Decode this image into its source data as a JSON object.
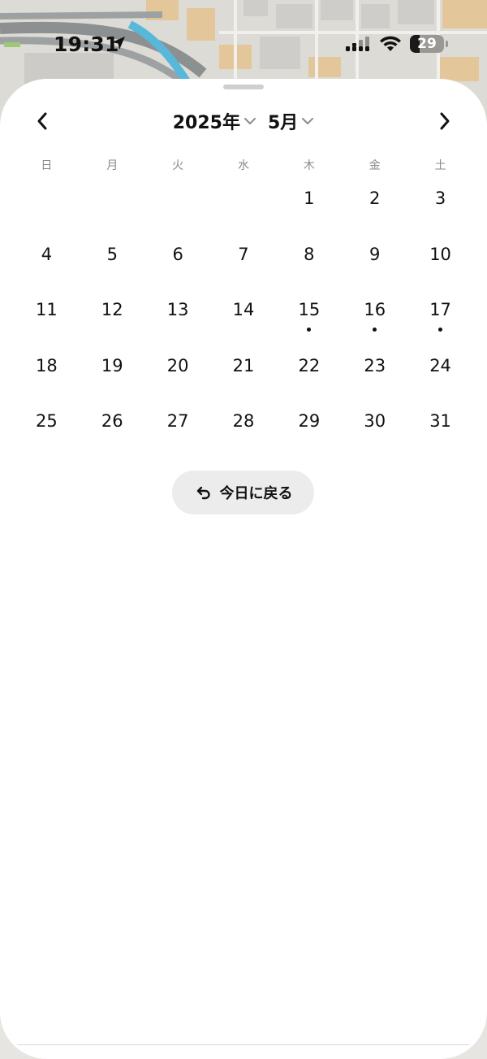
{
  "status_bar": {
    "time": "19:31",
    "battery_level": "29",
    "battery_fraction": 0.29
  },
  "icons": {
    "location": "location-arrow-icon",
    "signal": "cellular-signal-icon",
    "wifi": "wifi-icon",
    "battery": "battery-icon",
    "prev": "chevron-left-icon",
    "next": "chevron-right-icon",
    "dropdown": "chevron-down-icon",
    "back_to_today": "return-arrow-icon"
  },
  "calendar": {
    "year_label": "2025年",
    "month_label": "5月",
    "weekdays": [
      "日",
      "月",
      "火",
      "水",
      "木",
      "金",
      "土"
    ],
    "first_weekday_index": 4,
    "days": [
      "1",
      "2",
      "3",
      "4",
      "5",
      "6",
      "7",
      "8",
      "9",
      "10",
      "11",
      "12",
      "13",
      "14",
      "15",
      "16",
      "17",
      "18",
      "19",
      "20",
      "21",
      "22",
      "23",
      "24",
      "25",
      "26",
      "27",
      "28",
      "29",
      "30",
      "31"
    ],
    "days_with_events": [
      "15",
      "16",
      "17"
    ]
  },
  "actions": {
    "back_to_today_label": "今日に戻る"
  }
}
